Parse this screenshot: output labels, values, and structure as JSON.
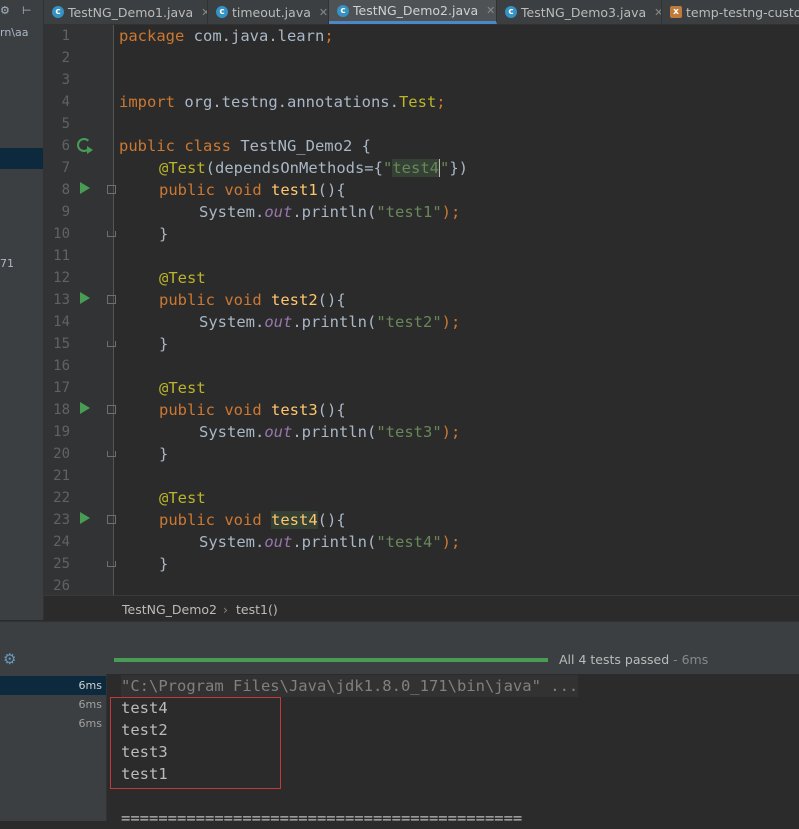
{
  "left_panel": {
    "top_icons": [
      "⚙",
      "⊢"
    ],
    "path_fragment": "rn\\aa",
    "version_fragment": "71"
  },
  "tabs": [
    {
      "label": "TestNG_Demo1.java",
      "icon": "class-icon",
      "active": false
    },
    {
      "label": "timeout.java",
      "icon": "class-icon",
      "active": false
    },
    {
      "label": "TestNG_Demo2.java",
      "icon": "class-icon",
      "active": true
    },
    {
      "label": "TestNG_Demo3.java",
      "icon": "class-icon",
      "active": false
    },
    {
      "label": "temp-testng-custo",
      "icon": "xml-file-icon",
      "active": false
    }
  ],
  "editor": {
    "line_numbers": [
      "1",
      "2",
      "3",
      "4",
      "5",
      "6",
      "7",
      "8",
      "9",
      "10",
      "11",
      "12",
      "13",
      "14",
      "15",
      "16",
      "17",
      "18",
      "19",
      "20",
      "21",
      "22",
      "23",
      "24",
      "25",
      "26"
    ],
    "code": {
      "l1_kw": "package",
      "l1_pkg": " com.java.learn",
      "l1_semi": ";",
      "l4_kw": "import",
      "l4_pkg": " org.testng.annotations.",
      "l4_cls": "Test",
      "l4_semi": ";",
      "l6_kw": "public class",
      "l6_name": " TestNG_Demo2 {",
      "l7_ann": "@Test",
      "l7_a": "(dependsOnMethods={",
      "l7_q1": "\"",
      "l7_str": "test4",
      "l7_q2": "\"",
      "l7_b": "})",
      "method_kw": "public void",
      "println_pre": "System.",
      "println_out": "out",
      "println_mid": ".println(",
      "println_end": ");",
      "close_brace": "}",
      "ann_test": "@Test",
      "m1_name": "test1",
      "m1_str": "\"test1\"",
      "m2_name": "test2",
      "m2_str": "\"test2\"",
      "m3_name": "test3",
      "m3_str": "\"test3\"",
      "m4_name": "test4",
      "m4_str": "\"test4\"",
      "parens": "(){"
    }
  },
  "breadcrumb": {
    "class_name": "TestNG_Demo2",
    "separator": "›",
    "method": "test1()"
  },
  "run_panel": {
    "status": "All 4 tests passed",
    "status_time": " - 6ms",
    "progress_fraction": 1.0,
    "tree_times": [
      "6ms",
      "6ms",
      "6ms"
    ],
    "command": "\"C:\\Program Files\\Java\\jdk1.8.0_171\\bin\\java\" ...",
    "output": [
      "test4",
      "test2",
      "test3",
      "test1"
    ],
    "separator": "==========================================="
  },
  "colors": {
    "accent": "#4a88c7",
    "pass_green": "#499c54",
    "highlight_box": "#c2393a"
  }
}
